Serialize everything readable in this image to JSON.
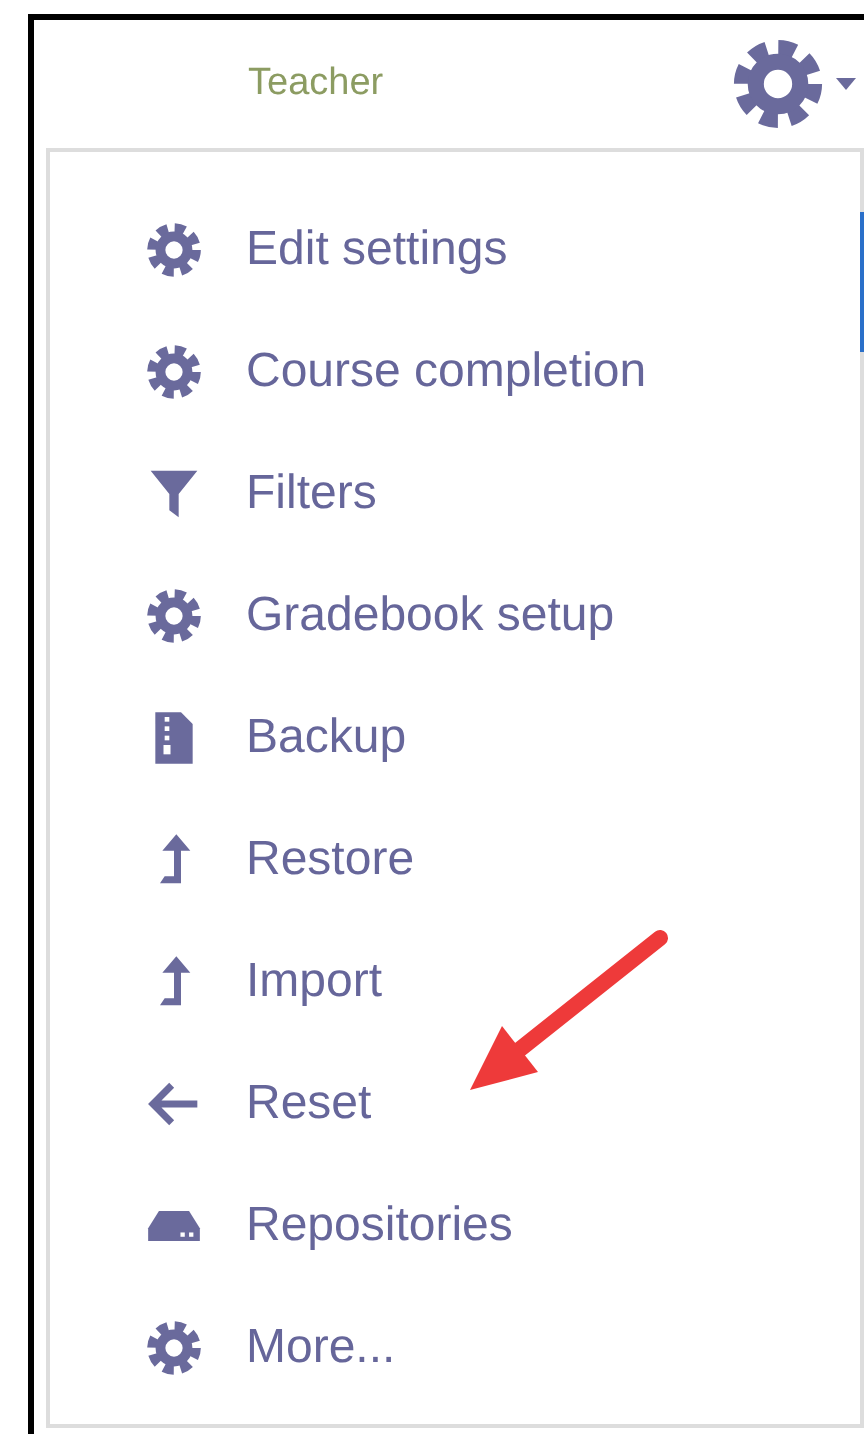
{
  "header": {
    "role": "Teacher"
  },
  "menu": {
    "items": [
      {
        "label": "Edit settings",
        "kind": "gear"
      },
      {
        "label": "Course completion",
        "kind": "gear"
      },
      {
        "label": "Filters",
        "kind": "filter"
      },
      {
        "label": "Gradebook setup",
        "kind": "gear"
      },
      {
        "label": "Backup",
        "kind": "archive"
      },
      {
        "label": "Restore",
        "kind": "levelup"
      },
      {
        "label": "Import",
        "kind": "levelup"
      },
      {
        "label": "Reset",
        "kind": "back"
      },
      {
        "label": "Repositories",
        "kind": "drive"
      },
      {
        "label": "More...",
        "kind": "gear"
      }
    ]
  }
}
